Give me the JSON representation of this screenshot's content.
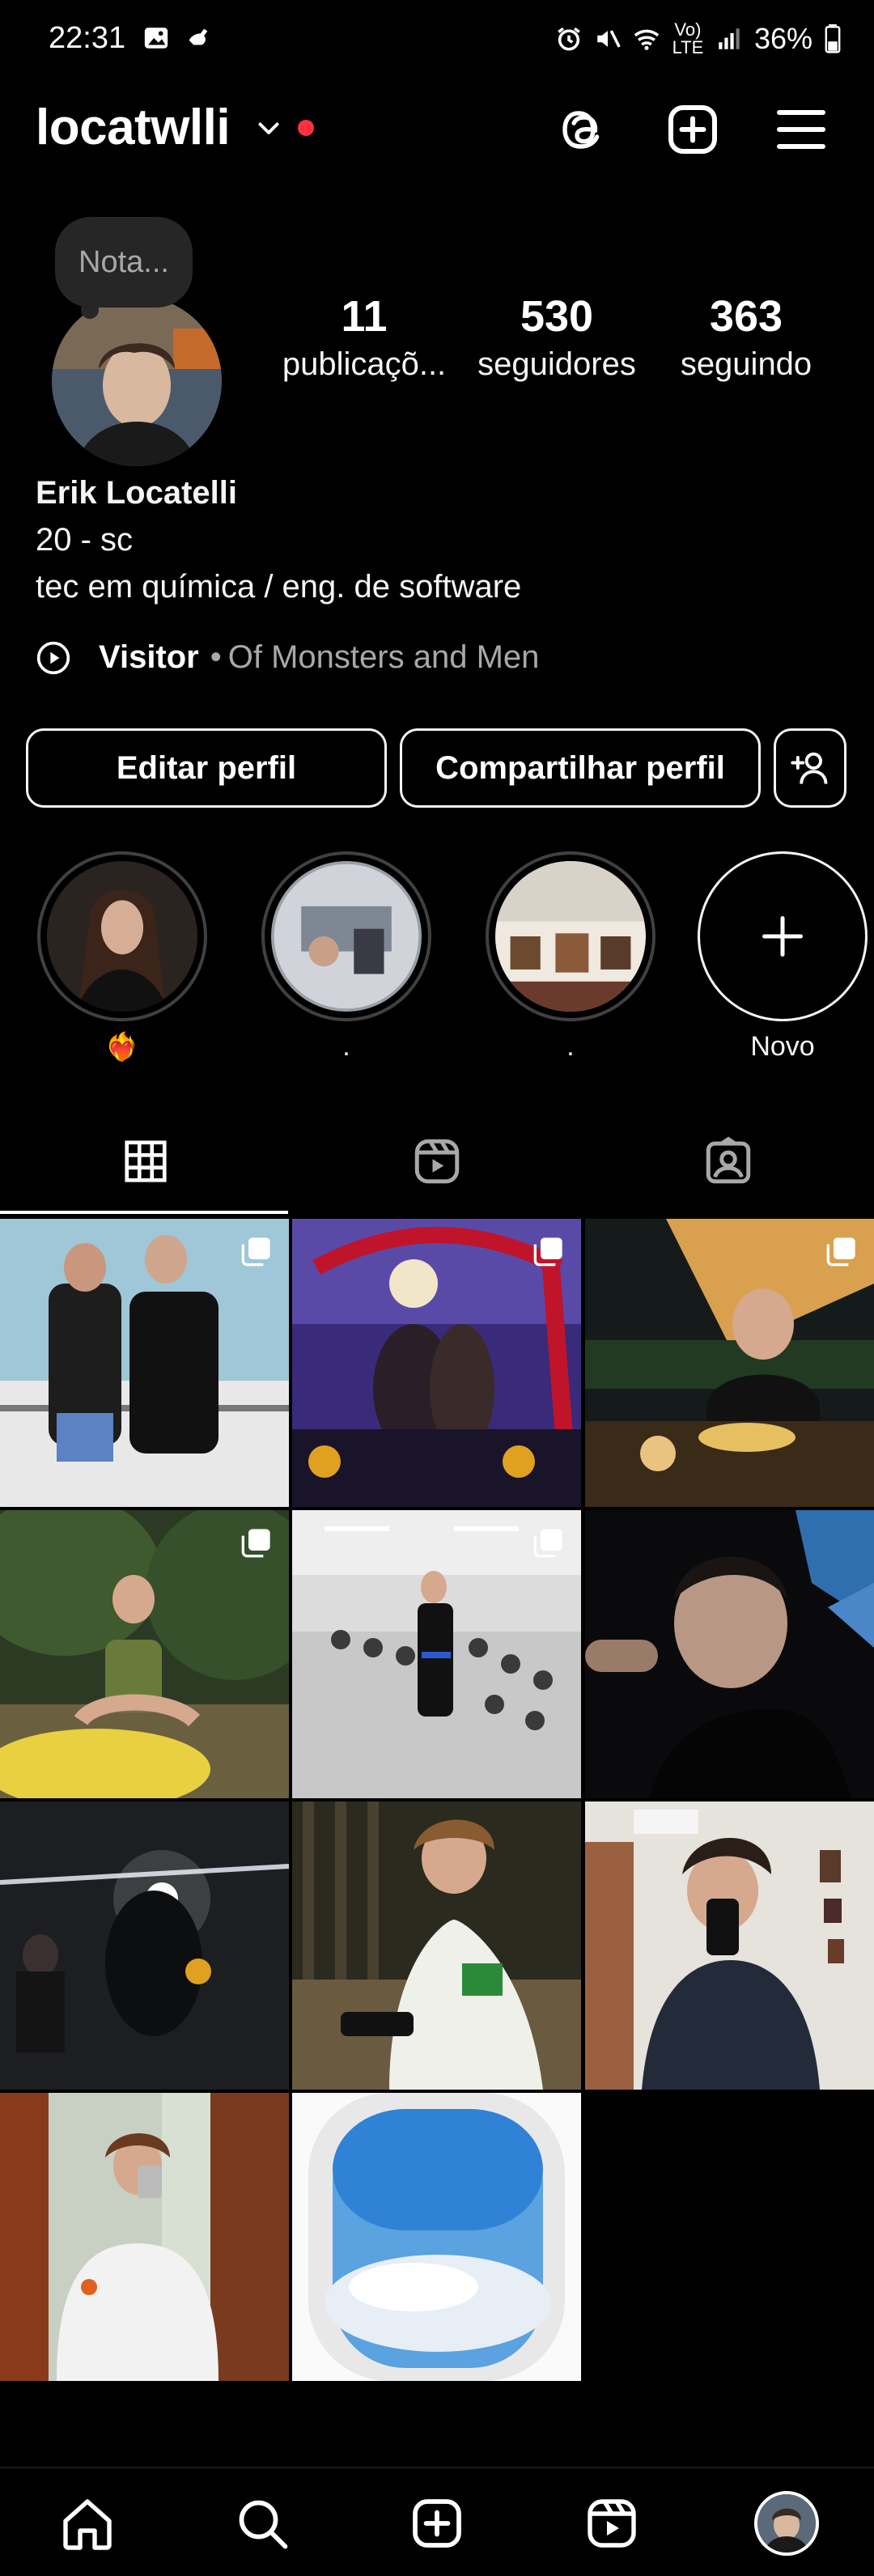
{
  "status_bar": {
    "time": "22:31",
    "battery": "36%",
    "network": "Vo) LTE"
  },
  "header": {
    "username": "locatwlli"
  },
  "note": {
    "placeholder": "Nota..."
  },
  "stats": [
    {
      "value": "11",
      "label": "publicaçõ..."
    },
    {
      "value": "530",
      "label": "seguidores"
    },
    {
      "value": "363",
      "label": "seguindo"
    }
  ],
  "bio": {
    "name": "Erik Locatelli",
    "line1": "20 - sc",
    "line2": "tec em química / eng. de software"
  },
  "music": {
    "title": "Visitor",
    "separator": "•",
    "artist": "Of Monsters and Men"
  },
  "buttons": {
    "edit": "Editar perfil",
    "share": "Compartilhar perfil"
  },
  "highlights": [
    {
      "label": "❤️‍🔥"
    },
    {
      "label": "."
    },
    {
      "label": "."
    },
    {
      "label": "Novo"
    }
  ],
  "colors": {
    "background": "#000000",
    "text": "#f5f5f5",
    "secondary": "#a8a8a8",
    "notification": "#ff3040"
  },
  "icons": {
    "header": [
      "threads-icon",
      "create-icon",
      "menu-icon"
    ],
    "tabs": [
      "grid-icon",
      "reels-icon",
      "tagged-icon"
    ],
    "nav": [
      "home-icon",
      "search-icon",
      "create-icon",
      "reels-icon",
      "profile-avatar"
    ]
  }
}
